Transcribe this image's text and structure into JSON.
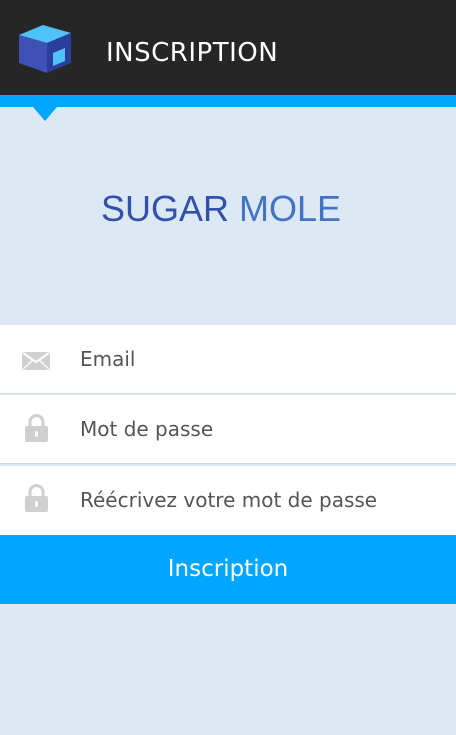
{
  "header": {
    "title": "INSCRIPTION",
    "logo_icon": "cube-logo-icon",
    "background_color": "#262626"
  },
  "accent_color": "#00a6ff",
  "brand": {
    "word1": "SUGAR",
    "word2": "MOLE"
  },
  "form": {
    "email": {
      "placeholder": "Email",
      "icon": "envelope-icon"
    },
    "password": {
      "placeholder": "Mot de passe",
      "icon": "lock-icon"
    },
    "password_confirm": {
      "placeholder": "Réécrivez votre mot de passe",
      "icon": "lock-icon"
    },
    "submit_label": "Inscription"
  }
}
